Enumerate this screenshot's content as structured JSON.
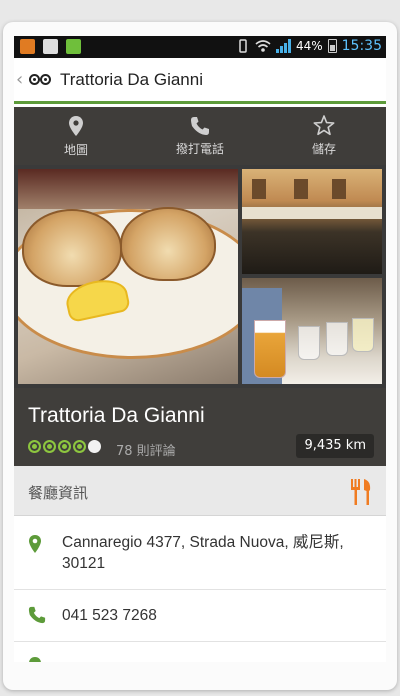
{
  "status_bar": {
    "battery": "44%",
    "time": "15:35"
  },
  "app_bar": {
    "title": "Trattoria Da Gianni"
  },
  "actions": [
    {
      "label": "地圖",
      "icon": "map-pin-icon"
    },
    {
      "label": "撥打電話",
      "icon": "phone-icon"
    },
    {
      "label": "儲存",
      "icon": "star-icon"
    }
  ],
  "restaurant": {
    "name": "Trattoria Da Gianni",
    "rating_bubbles": 4,
    "rating_max": 5,
    "reviews": "78 則評論",
    "distance": "9,435 km"
  },
  "info": {
    "header": "餐廳資訊",
    "address": "Cannaregio 4377, Strada Nuova, 威尼斯, 30121",
    "phone": "041 523 7268"
  },
  "colors": {
    "accent_green": "#5d9b3a",
    "bubble_green": "#8dc63f",
    "dark_bar": "#403e3b",
    "cutlery_orange": "#f07c22",
    "time_blue": "#5ec3ff"
  }
}
